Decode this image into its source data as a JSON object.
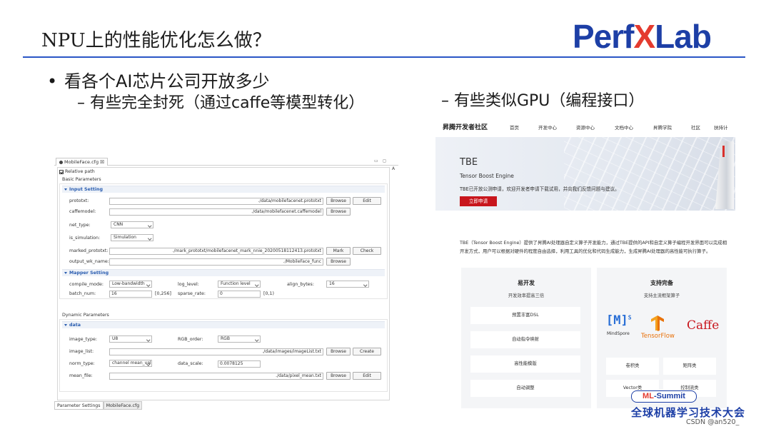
{
  "slide": {
    "title": "NPU上的性能优化怎么做？",
    "logo": {
      "part1": "Perf",
      "part2": "X",
      "part3": "Lab"
    },
    "bullet1": "看各个AI芯片公司开放多少",
    "bullet2": "– 有些完全封死（通过caffe等模型转化）",
    "bullet3": "– 有些类似GPU（编程接口）",
    "bullet_symbol": "•"
  },
  "config_window": {
    "tab_title": "MobileFace.cfg",
    "tab_close": "☒",
    "win_min": "▭",
    "win_max": "◻",
    "side_letter": "A",
    "relative_path_label": "Relative path",
    "basic_parameters": "Basic Parameters",
    "input_setting": "Input Setting",
    "prototxt_label": "prototxt:",
    "prototxt_value": "./data/mobilefacenet.prototxt",
    "caffemodel_label": "caffemodel:",
    "caffemodel_value": "./data/mobilefacenet.caffemodel",
    "net_type_label": "net_type:",
    "net_type_value": "CNN",
    "is_simulation_label": "is_simulation:",
    "is_simulation_value": "Simulation",
    "marked_prototxt_label": "marked_prototxt:",
    "marked_prototxt_value": "./mark_prototxt/mobilefacenet_mark_nnie_20200518112413.prototxt",
    "output_wk_name_label": "output_wk_name:",
    "output_wk_name_value": "./MobileFace_func",
    "browse": "Browse",
    "edit": "Edit",
    "mark": "Mark",
    "check": "Check",
    "create": "Create",
    "mapper_setting": "Mapper Setting",
    "compile_mode_label": "compile_mode:",
    "compile_mode_value": "Low-bandwidth",
    "log_level_label": "log_level:",
    "log_level_value": "Function level",
    "align_bytes_label": "align_bytes:",
    "align_bytes_value": "16",
    "batch_num_label": "batch_num:",
    "batch_num_value": "16",
    "batch_num_range": "[0,256]",
    "sparse_rate_label": "sparse_rate:",
    "sparse_rate_value": "0",
    "sparse_rate_range": "[0,1)",
    "dynamic_parameters": "Dynamic Parameters",
    "data_section": "data",
    "image_type_label": "image_type:",
    "image_type_value": "U8",
    "rgb_order_label": "RGB_order:",
    "rgb_order_value": "RGB",
    "image_list_label": "image_list:",
    "image_list_value": "./data/images/imageList.txt",
    "norm_type_label": "norm_type:",
    "norm_type_value": "channel mean_val",
    "data_scale_label": "data_scale:",
    "data_scale_value": "0.0078125",
    "mean_file_label": "mean_file:",
    "mean_file_value": "./data/pixel_mean.txt",
    "bottom_tab1": "Parameter Settings",
    "bottom_tab2": "MobileFace.cfg"
  },
  "web": {
    "brand": "昇腾开发者社区",
    "nav": [
      "首页",
      "开发中心",
      "资源中心",
      "文档中心",
      "昇腾学院",
      "社区",
      "扶持计"
    ],
    "banner_title": "TBE",
    "banner_subtitle": "Tensor Boost Engine",
    "banner_desc": "TBE已开放公测申请，欢迎开发者申请下载试用，并向我们反馈问题与建议。",
    "apply_button": "立即申请",
    "intro_line1": "TBE（Tensor Boost Engine）提供了昇腾AI处理器自定义算子开发能力，通过TBE提供的API和自定义算子编程开发界面可以完成相",
    "intro_line2": "开发方式，用户可以根据对硬件的程度自由选择，利用工具的优化和代码生成能力，生成昇腾AI处理器的高性能可执行算子。",
    "card1": {
      "title": "易开发",
      "subtitle": "开发效率提高三倍",
      "items": [
        "预置丰富DSL",
        "自动指令映射",
        "高性能模版",
        "自动调整"
      ]
    },
    "card2": {
      "title": "支持完备",
      "subtitle": "支持主流框架算子",
      "mindspore_mark": "[M]",
      "mindspore_sup": "S",
      "mindspore_name": "MindSpore",
      "tensorflow_name": "TensorFlow",
      "caffe_name": "Caffe",
      "items": [
        "卷积类",
        "矩阵类",
        "Vector类",
        "控制流类"
      ]
    }
  },
  "branding": {
    "ml_prefix": "ML",
    "ml_suffix": "-Summit",
    "conference": "全球机器学习技术大会",
    "watermark": "CSDN @an520_"
  },
  "colors": {
    "accent_blue": "#1d3fa6",
    "accent_red": "#e43b2f",
    "section_blue": "#2a5db0",
    "apply_red": "#c8161d"
  }
}
